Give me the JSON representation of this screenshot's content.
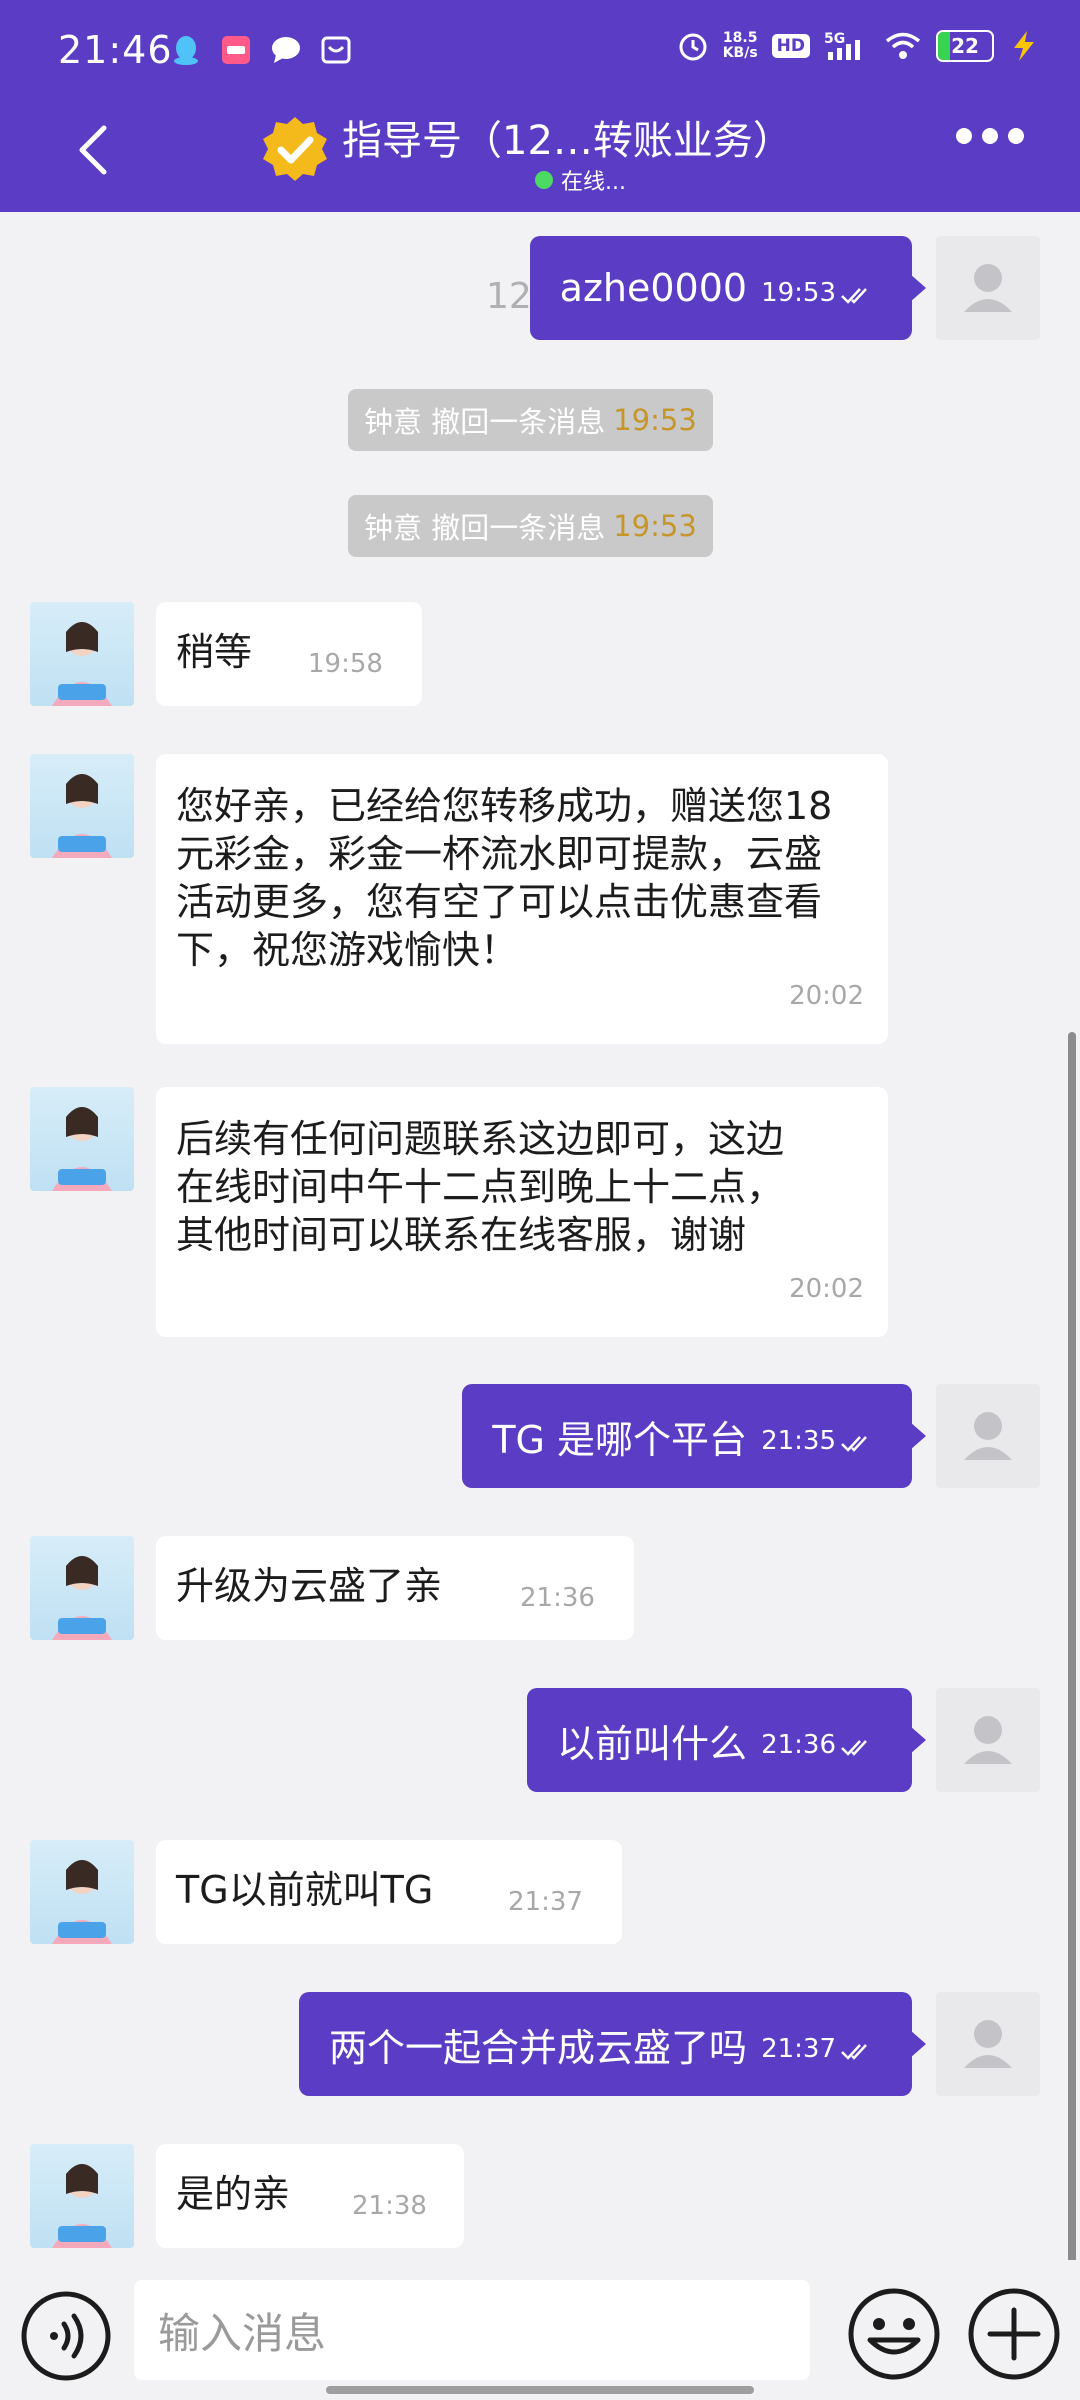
{
  "status_bar": {
    "time": "21:46",
    "net_speed_value": "18.5",
    "net_speed_unit": "KB/s",
    "hd": "HD",
    "signal": "5G",
    "battery": "22"
  },
  "header": {
    "title": "指导号（12…转账业务）",
    "status": "在线..."
  },
  "chat": {
    "date_watermark": "12/28",
    "system_notices": [
      {
        "text": "钟意 撤回一条消息",
        "time": "19:53"
      },
      {
        "text": "钟意 撤回一条消息",
        "time": "19:53"
      }
    ],
    "messages": [
      {
        "side": "out",
        "text": "azhe0000",
        "time": "19:53"
      },
      {
        "side": "in",
        "text": "稍等",
        "time": "19:58"
      },
      {
        "side": "in",
        "text": "您好亲，已经给您转移成功，赠送您18元彩金，彩金一杯流水即可提款，云盛活动更多，您有空了可以点击优惠查看下，祝您游戏愉快！",
        "time": "20:02"
      },
      {
        "side": "in",
        "text": "后续有任何问题联系这边即可，这边在线时间中午十二点到晚上十二点，其他时间可以联系在线客服，谢谢",
        "time": "20:02"
      },
      {
        "side": "out",
        "text": "TG 是哪个平台",
        "time": "21:35"
      },
      {
        "side": "in",
        "text": "升级为云盛了亲",
        "time": "21:36"
      },
      {
        "side": "out",
        "text": "以前叫什么",
        "time": "21:36"
      },
      {
        "side": "in",
        "text": "TG以前就叫TG",
        "time": "21:37"
      },
      {
        "side": "out",
        "text": "两个一起合并成云盛了吗",
        "time": "21:37"
      },
      {
        "side": "in",
        "text": "是的亲",
        "time": "21:38"
      }
    ],
    "agent_avatar_label": "指导号"
  },
  "input": {
    "placeholder": "输入消息"
  },
  "colors": {
    "brand": "#5b3cc4",
    "notice_time": "#c7962b",
    "background": "#f2f2f4"
  }
}
